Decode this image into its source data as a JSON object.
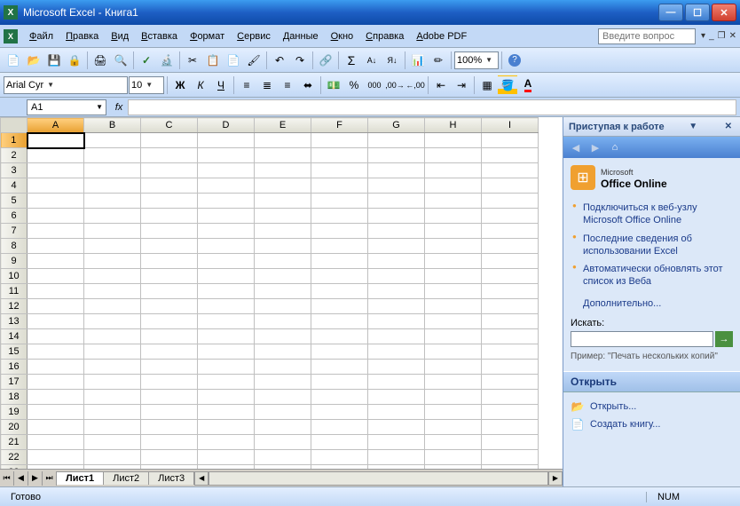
{
  "titlebar": {
    "title": "Microsoft Excel - Книга1"
  },
  "menubar": {
    "items": [
      "Файл",
      "Правка",
      "Вид",
      "Вставка",
      "Формат",
      "Сервис",
      "Данные",
      "Окно",
      "Справка",
      "Adobe PDF"
    ],
    "help_placeholder": "Введите вопрос"
  },
  "toolbar1": {
    "zoom": "100%"
  },
  "toolbar2": {
    "font": "Arial Cyr",
    "size": "10",
    "bold": "Ж",
    "italic": "К",
    "underline": "Ч"
  },
  "formula": {
    "namebox": "A1",
    "fx": "fx"
  },
  "grid": {
    "cols": [
      "A",
      "B",
      "C",
      "D",
      "E",
      "F",
      "G",
      "H",
      "I"
    ],
    "rowcount": 23,
    "active": "A1"
  },
  "sheettabs": {
    "tabs": [
      "Лист1",
      "Лист2",
      "Лист3"
    ],
    "active": 0
  },
  "taskpane": {
    "title": "Приступая к работе",
    "office_brand_pre": "Microsoft",
    "office_brand": "Office Online",
    "links": [
      "Подключиться к веб-узлу Microsoft Office Online",
      "Последние сведения об использовании Excel",
      "Автоматически обновлять этот список из Веба"
    ],
    "more": "Дополнительно...",
    "search_label": "Искать:",
    "example_pre": "Пример:",
    "example": "\"Печать нескольких копий\"",
    "open_header": "Открыть",
    "open_link": "Открыть...",
    "create_link": "Создать книгу..."
  },
  "statusbar": {
    "ready": "Готово",
    "num": "NUM"
  }
}
